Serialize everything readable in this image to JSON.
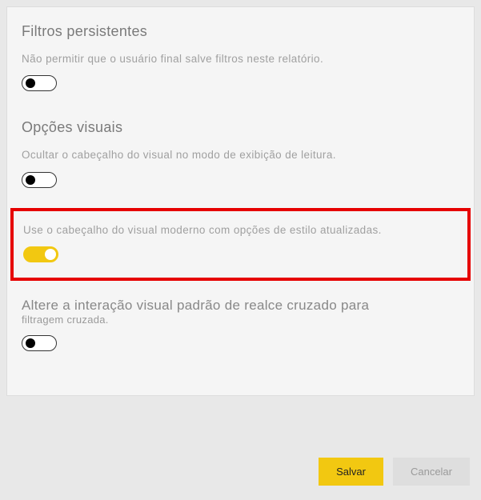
{
  "sections": {
    "persistent_filters": {
      "title": "Filtros persistentes",
      "option_desc": "Não permitir que o usuário final salve filtros neste relatório."
    },
    "visual_options": {
      "title": "Opções visuais",
      "hide_header_desc": "Ocultar o cabeçalho do visual no modo de exibição de leitura.",
      "modern_header_desc": "Use o cabeçalho do visual moderno com opções de estilo atualizadas.",
      "cross_filter_title": "Altere a interação visual padrão de realce cruzado para",
      "cross_filter_sub": "filtragem cruzada."
    }
  },
  "toggles": {
    "persistent_filters": false,
    "hide_header": false,
    "modern_header": true,
    "cross_filter": false
  },
  "buttons": {
    "save": "Salvar",
    "cancel": "Cancelar"
  },
  "colors": {
    "accent": "#f2c811",
    "highlight_border": "#e60000"
  }
}
